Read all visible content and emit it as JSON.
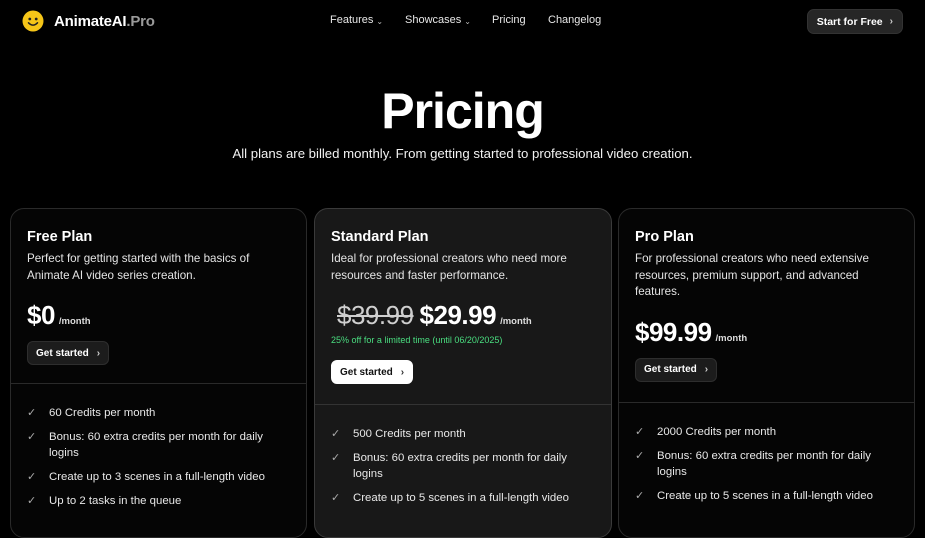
{
  "brand": {
    "name": "AnimateAI",
    "suffix": ".Pro"
  },
  "nav": {
    "items": [
      {
        "label": "Features",
        "dropdown": true
      },
      {
        "label": "Showcases",
        "dropdown": true
      },
      {
        "label": "Pricing",
        "dropdown": false
      },
      {
        "label": "Changelog",
        "dropdown": false
      }
    ],
    "cta": "Start for Free"
  },
  "hero": {
    "title": "Pricing",
    "subtitle": "All plans are billed monthly. From getting started to professional video creation."
  },
  "plans": [
    {
      "name": "Free Plan",
      "description": "Perfect for getting started with the basics of Animate AI video series creation.",
      "price": "$0",
      "period": "/month",
      "button": "Get started",
      "features": [
        "60 Credits per month",
        "Bonus: 60 extra credits per month for daily logins",
        "Create up to 3 scenes in a full-length video",
        "Up to 2 tasks in the queue"
      ]
    },
    {
      "name": "Standard Plan",
      "description": "Ideal for professional creators who need more resources and faster performance.",
      "old_price": "$39.99",
      "price": "$29.99",
      "period": "/month",
      "promo": "25% off for a limited time (until 06/20/2025)",
      "button": "Get started",
      "features": [
        "500 Credits per month",
        "Bonus: 60 extra credits per month for daily logins",
        "Create up to 5 scenes in a full-length video"
      ]
    },
    {
      "name": "Pro Plan",
      "description": "For professional creators who need extensive resources, premium support, and advanced features.",
      "price": "$99.99",
      "period": "/month",
      "button": "Get started",
      "features": [
        "2000 Credits per month",
        "Bonus: 60 extra credits per month for daily logins",
        "Create up to 5 scenes in a full-length video"
      ]
    }
  ],
  "colors": {
    "promo": "#4ade80",
    "brand_icon": "#f5c518"
  }
}
